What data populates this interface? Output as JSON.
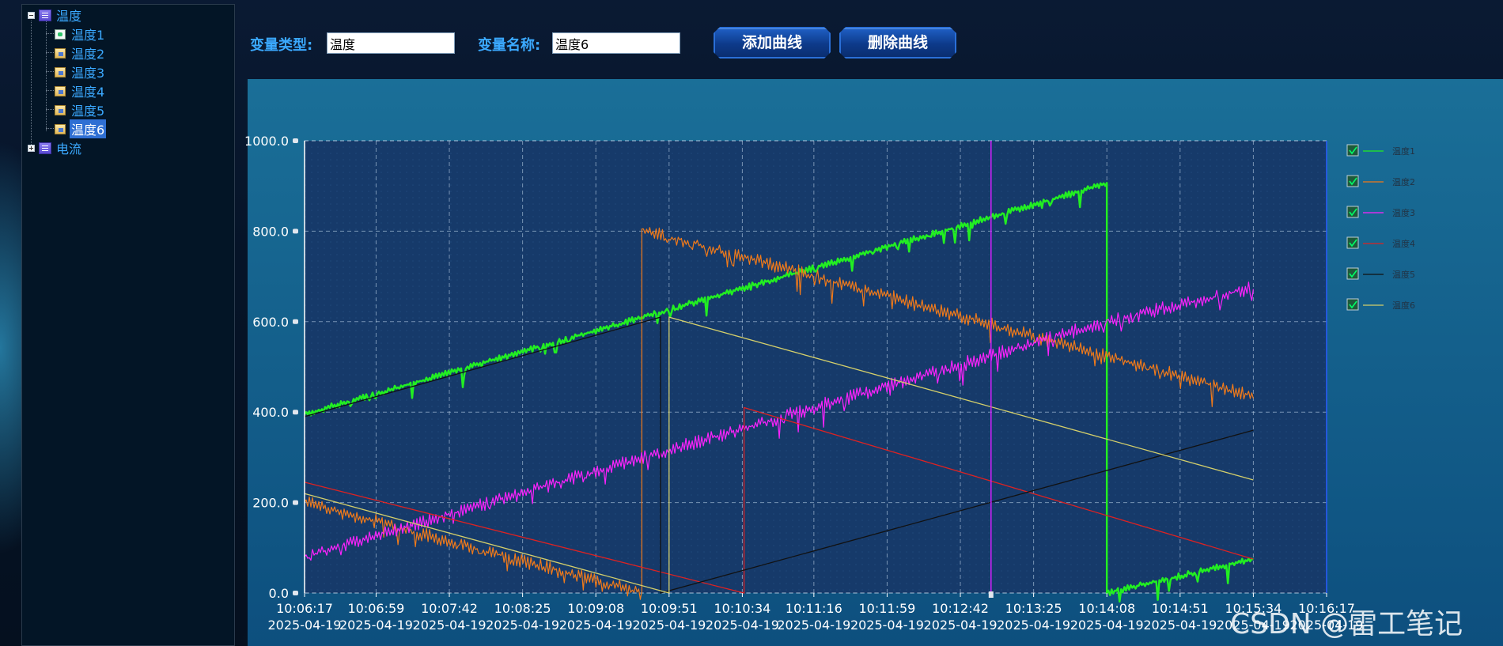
{
  "tree": {
    "root1": {
      "label": "温度",
      "expanded": true
    },
    "children": [
      {
        "label": "温度1",
        "icon": "document-icon"
      },
      {
        "label": "温度2",
        "icon": "config-icon"
      },
      {
        "label": "温度3",
        "icon": "config-icon"
      },
      {
        "label": "温度4",
        "icon": "config-icon"
      },
      {
        "label": "温度5",
        "icon": "config-icon"
      },
      {
        "label": "温度6",
        "icon": "config-icon",
        "selected": true
      }
    ],
    "root2": {
      "label": "电流",
      "expanded": false
    }
  },
  "controls": {
    "type_label": "变量类型:",
    "type_value": "温度",
    "name_label": "变量名称:",
    "name_value": "温度6",
    "add_button": "添加曲线",
    "delete_button": "删除曲线"
  },
  "watermark": "CSDN @雷工笔记",
  "chart_data": {
    "type": "line",
    "ylim": [
      0,
      1000
    ],
    "yticks": [
      "1000.0",
      "800.0",
      "600.0",
      "400.0",
      "200.0",
      "0.0"
    ],
    "ytick_values": [
      1000,
      800,
      600,
      400,
      200,
      0
    ],
    "xlim": [
      "10:06:17",
      "10:16:17"
    ],
    "xticks_time": [
      "10:06:17",
      "10:06:59",
      "10:07:42",
      "10:08:25",
      "10:09:08",
      "10:09:51",
      "10:10:34",
      "10:11:16",
      "10:11:59",
      "10:12:42",
      "10:13:25",
      "10:14:08",
      "10:14:51",
      "10:15:34",
      "10:16:17"
    ],
    "xticks_date": "2025-04-19",
    "cursor_time": "10:13:00",
    "grid": true,
    "legend_position": "right",
    "series": [
      {
        "name": "温度1",
        "color": "#22ee22",
        "points": [
          [
            "10:06:17",
            395
          ],
          [
            "10:14:08",
            905
          ],
          [
            "10:14:08",
            0
          ],
          [
            "10:15:34",
            75
          ]
        ]
      },
      {
        "name": "温度2",
        "color": "#f07a1a",
        "points": [
          [
            "10:06:17",
            200
          ],
          [
            "10:09:35",
            0
          ],
          [
            "10:09:35",
            805
          ],
          [
            "10:15:34",
            435
          ]
        ]
      },
      {
        "name": "温度3",
        "color": "#ff22ff",
        "points": [
          [
            "10:06:17",
            80
          ],
          [
            "10:14:08",
            600
          ],
          [
            "10:15:34",
            675
          ]
        ]
      },
      {
        "name": "温度4",
        "color": "#dd2222",
        "points": [
          [
            "10:06:17",
            245
          ],
          [
            "10:10:35",
            0
          ],
          [
            "10:10:35",
            410
          ],
          [
            "10:15:34",
            75
          ]
        ]
      },
      {
        "name": "温度5",
        "color": "#111111",
        "points": [
          [
            "10:06:17",
            390
          ],
          [
            "10:09:46",
            610
          ],
          [
            "10:09:46",
            0
          ],
          [
            "10:15:34",
            360
          ]
        ]
      },
      {
        "name": "温度6",
        "color": "#d4cf6a",
        "points": [
          [
            "10:06:17",
            220
          ],
          [
            "10:09:51",
            0
          ],
          [
            "10:09:51",
            610
          ],
          [
            "10:15:34",
            250
          ]
        ]
      }
    ],
    "noisy_series": [
      "温度1",
      "温度2",
      "温度3"
    ]
  }
}
